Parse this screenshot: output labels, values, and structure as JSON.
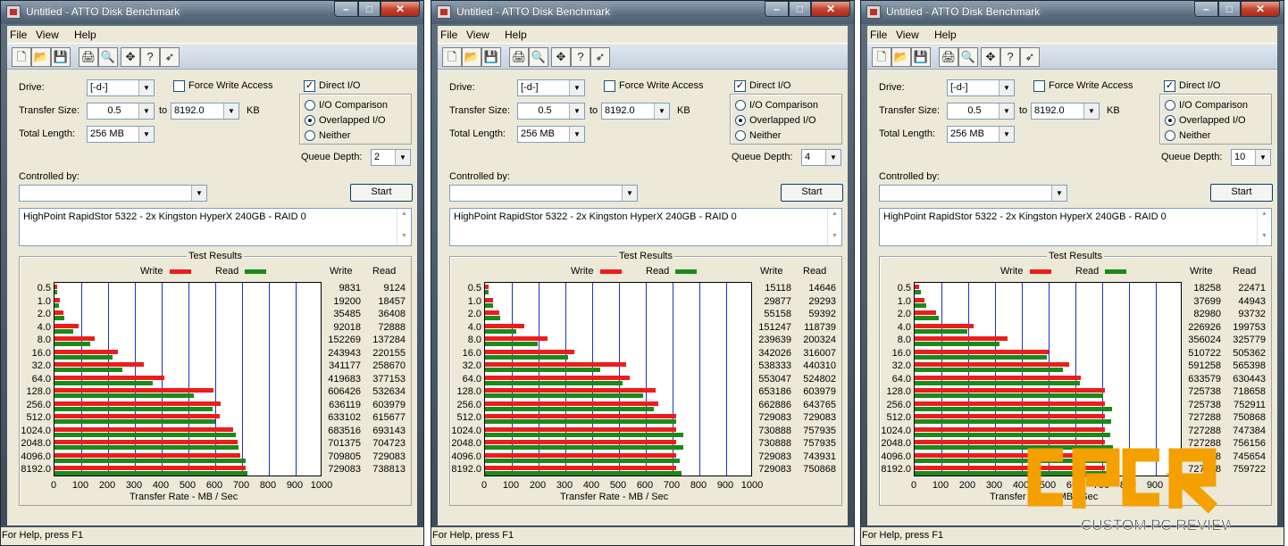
{
  "windows": [
    {
      "title": "Untitled - ATTO Disk Benchmark",
      "queue_depth": "2",
      "write": [
        "9831",
        "19200",
        "35485",
        "92018",
        "152269",
        "243943",
        "341177",
        "419683",
        "606426",
        "636119",
        "633102",
        "683516",
        "701375",
        "709805",
        "729083"
      ],
      "read": [
        "9124",
        "18457",
        "36408",
        "72888",
        "137284",
        "220155",
        "258670",
        "377153",
        "532634",
        "603979",
        "615677",
        "693143",
        "704723",
        "729083",
        "738813"
      ]
    },
    {
      "title": "Untitled - ATTO Disk Benchmark",
      "queue_depth": "4",
      "write": [
        "15118",
        "29877",
        "55158",
        "151247",
        "239639",
        "342026",
        "538333",
        "553047",
        "653186",
        "662886",
        "729083",
        "730888",
        "730888",
        "729083",
        "729083"
      ],
      "read": [
        "14646",
        "29293",
        "59392",
        "118739",
        "200324",
        "316007",
        "440310",
        "524802",
        "603979",
        "643765",
        "729083",
        "757935",
        "757935",
        "743931",
        "750868"
      ]
    },
    {
      "title": "Untitled - ATTO Disk Benchmark",
      "queue_depth": "10",
      "write": [
        "18258",
        "37699",
        "82980",
        "226926",
        "356024",
        "510722",
        "591258",
        "633579",
        "725738",
        "725738",
        "727288",
        "727288",
        "727288",
        "727288",
        "727288"
      ],
      "read": [
        "22471",
        "44943",
        "93732",
        "199753",
        "325779",
        "505362",
        "565398",
        "630443",
        "718658",
        "752911",
        "750868",
        "747384",
        "756156",
        "745654",
        "759722"
      ]
    }
  ],
  "menu": [
    "File",
    "View",
    "Help"
  ],
  "labels": {
    "drive": "Drive:",
    "drive_value": "[-d-]",
    "transfer_size": "Transfer Size:",
    "ts_from": "0.5",
    "to": "to",
    "ts_to": "8192.0",
    "kb": "KB",
    "total_length": "Total Length:",
    "total_length_value": "256 MB",
    "force_write": "Force Write Access",
    "direct_io": "Direct I/O",
    "io_comparison": "I/O Comparison",
    "overlapped_io": "Overlapped I/O",
    "neither": "Neither",
    "queue_depth": "Queue Depth:",
    "controlled_by": "Controlled by:",
    "start": "Start",
    "description": "HighPoint RapidStor 5322 - 2x Kingston HyperX 240GB - RAID 0",
    "test_results": "Test Results",
    "write": "Write",
    "read": "Read",
    "x_axis": "Transfer Rate - MB / Sec",
    "status": "For Help, press F1"
  },
  "icons": [
    "new-icon",
    "open-icon",
    "save-icon",
    "print-icon",
    "print-preview-icon",
    "move-icon",
    "help-icon",
    "context-help-icon"
  ],
  "colors": {
    "write": "#ee1c1c",
    "read": "#1a8a1a",
    "grid": "#2030c8"
  },
  "chart_data": [
    {
      "type": "bar",
      "categories": [
        "0.5",
        "1.0",
        "2.0",
        "4.0",
        "8.0",
        "16.0",
        "32.0",
        "64.0",
        "128.0",
        "256.0",
        "512.0",
        "1024.0",
        "2048.0",
        "4096.0",
        "8192.0"
      ],
      "series": [
        {
          "name": "Write",
          "values": [
            9.6,
            18.75,
            34.65,
            89.86,
            148.7,
            238.23,
            333.18,
            409.85,
            592.21,
            621.21,
            618.26,
            667.5,
            684.94,
            693.17,
            712.0
          ]
        },
        {
          "name": "Read",
          "values": [
            8.91,
            18.02,
            35.55,
            71.18,
            134.07,
            215.0,
            252.61,
            368.31,
            520.15,
            589.82,
            601.25,
            676.9,
            688.2,
            712.0,
            721.5
          ]
        }
      ],
      "xlabel": "Transfer Rate - MB / Sec",
      "xlim": [
        0,
        1000
      ]
    },
    {
      "type": "bar",
      "categories": [
        "0.5",
        "1.0",
        "2.0",
        "4.0",
        "8.0",
        "16.0",
        "32.0",
        "64.0",
        "128.0",
        "256.0",
        "512.0",
        "1024.0",
        "2048.0",
        "4096.0",
        "8192.0"
      ],
      "series": [
        {
          "name": "Write",
          "values": [
            14.76,
            29.18,
            53.87,
            147.7,
            234.02,
            334.01,
            525.72,
            540.08,
            637.88,
            647.35,
            712.0,
            713.76,
            713.76,
            712.0,
            712.0
          ]
        },
        {
          "name": "Read",
          "values": [
            14.3,
            28.61,
            58.0,
            115.96,
            195.63,
            308.6,
            429.99,
            512.5,
            589.82,
            628.68,
            712.0,
            740.17,
            740.17,
            726.5,
            733.27
          ]
        }
      ],
      "xlabel": "Transfer Rate - MB / Sec",
      "xlim": [
        0,
        1000
      ]
    },
    {
      "type": "bar",
      "categories": [
        "0.5",
        "1.0",
        "2.0",
        "4.0",
        "8.0",
        "16.0",
        "32.0",
        "64.0",
        "128.0",
        "256.0",
        "512.0",
        "1024.0",
        "2048.0",
        "4096.0",
        "8192.0"
      ],
      "series": [
        {
          "name": "Write",
          "values": [
            17.83,
            36.82,
            81.04,
            221.61,
            347.68,
            498.75,
            577.4,
            618.73,
            708.73,
            708.73,
            710.24,
            710.24,
            710.24,
            710.24,
            710.24
          ]
        },
        {
          "name": "Read",
          "values": [
            21.94,
            43.89,
            91.54,
            195.07,
            318.14,
            493.52,
            552.15,
            615.67,
            701.81,
            735.27,
            733.27,
            729.87,
            738.43,
            728.18,
            741.92
          ]
        }
      ],
      "xlabel": "Transfer Rate - MB / Sec",
      "xlim": [
        0,
        1000
      ]
    }
  ],
  "x_ticks": [
    "0",
    "100",
    "200",
    "300",
    "400",
    "500",
    "600",
    "700",
    "800",
    "900",
    "1000"
  ],
  "watermark": {
    "logo_text": "CPCR",
    "tagline": "CUSTOM PC REVIEW",
    "color": "#f4a000"
  }
}
